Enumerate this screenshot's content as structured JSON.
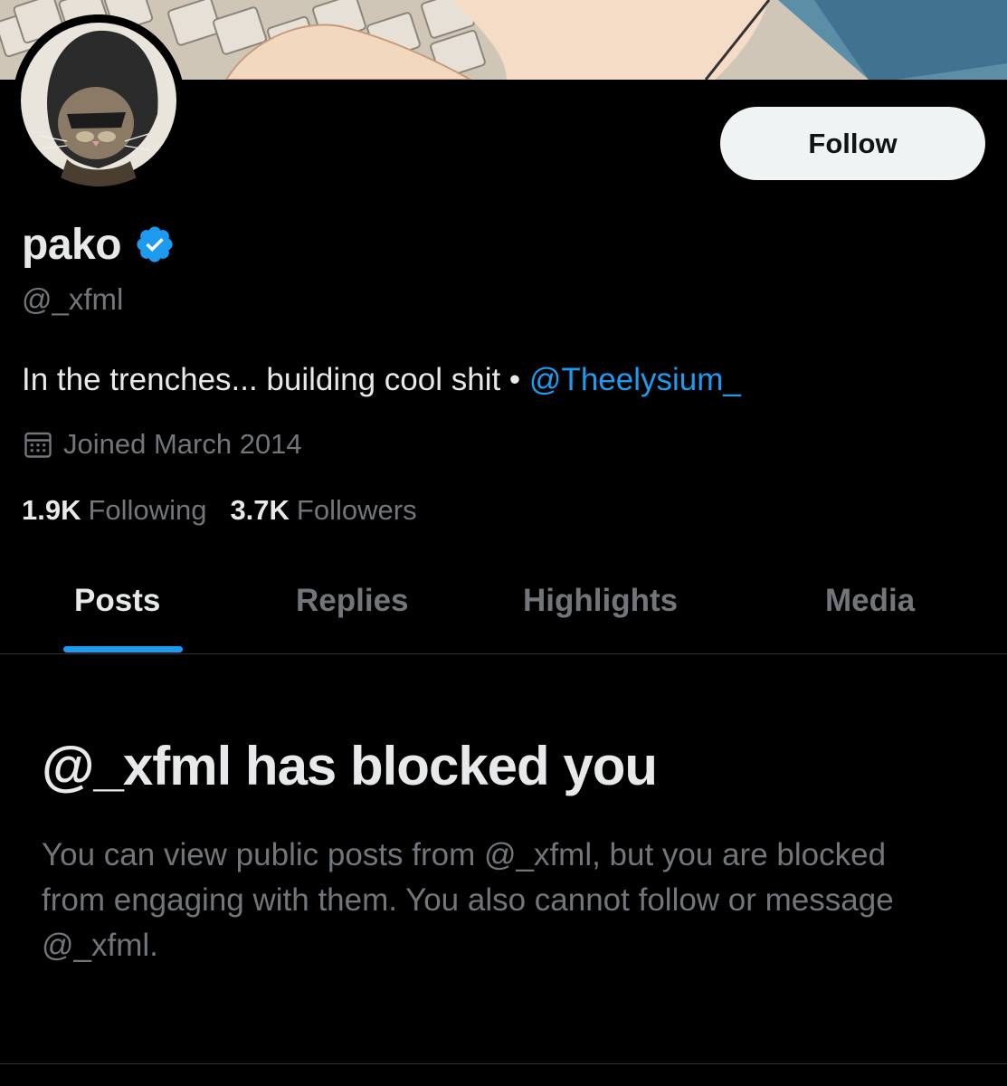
{
  "profile": {
    "display_name": "pako",
    "handle": "@_xfml",
    "bio_text": "In the trenches... building cool shit • ",
    "bio_mention": "@Theelysium_",
    "joined": "Joined March 2014",
    "verified": true
  },
  "actions": {
    "follow_label": "Follow"
  },
  "stats": {
    "following_count": "1.9K",
    "following_label": "Following",
    "followers_count": "3.7K",
    "followers_label": "Followers"
  },
  "tabs": [
    {
      "label": "Posts",
      "active": true
    },
    {
      "label": "Replies",
      "active": false
    },
    {
      "label": "Highlights",
      "active": false
    },
    {
      "label": "Media",
      "active": false
    }
  ],
  "blocked": {
    "title": "@_xfml has blocked you",
    "body": "You can view public posts from @_xfml, but you are blocked from engaging with them. You also cannot follow or message @_xfml."
  },
  "colors": {
    "background": "#000000",
    "primary_text": "#e7e9ea",
    "secondary_text": "#71767b",
    "accent": "#1d9bf0",
    "follow_button_bg": "#eff3f4",
    "divider": "#2f3336"
  },
  "icons": {
    "verified": "verified-badge-icon",
    "calendar": "calendar-icon"
  }
}
